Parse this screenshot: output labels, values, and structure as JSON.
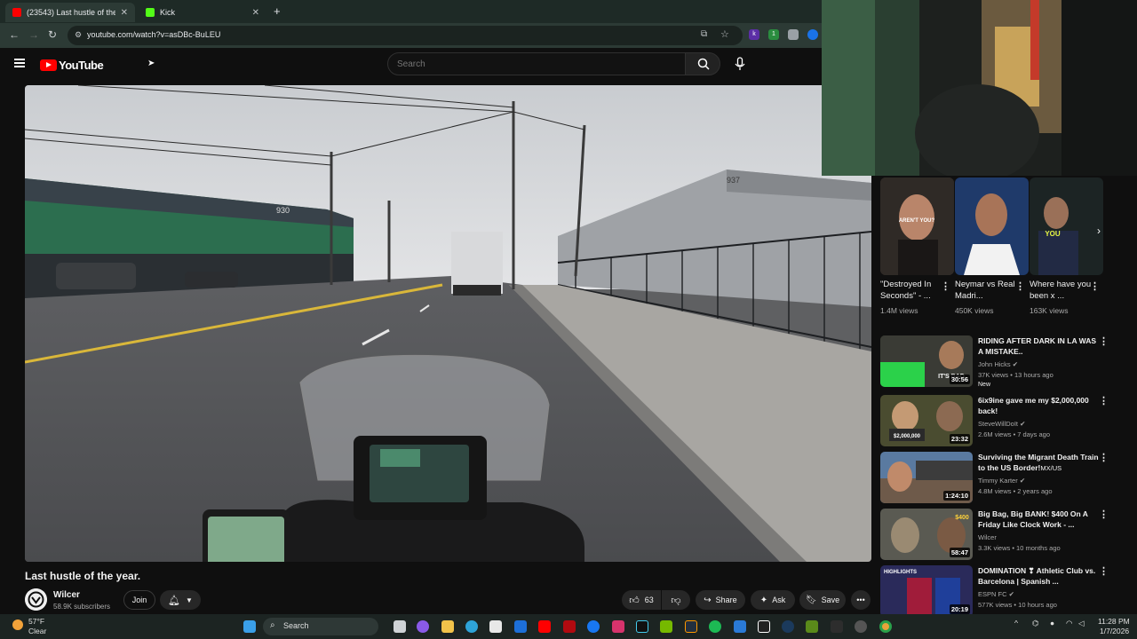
{
  "browser": {
    "tabs": [
      {
        "title": "(23543) Last hustle of the year.",
        "active": true,
        "favicon_color": "#ff0000"
      },
      {
        "title": "Kick",
        "active": false,
        "favicon_color": "#53fc18"
      }
    ],
    "url": "youtube.com/watch?v=asDBc-BuLEU"
  },
  "youtube": {
    "logo_text": "YouTube",
    "search_placeholder": "Search"
  },
  "video": {
    "title": "Last hustle of the year.",
    "channel": "Wilcer",
    "subscribers": "58.9K subscribers",
    "join_label": "Join",
    "likes": "63",
    "share_label": "Share",
    "ask_label": "Ask",
    "save_label": "Save",
    "scene_numbers": {
      "building_left": "930",
      "building_right": "937"
    }
  },
  "shorts": [
    {
      "title": "\"Destroyed In Seconds\" - ...",
      "views": "1.4M views",
      "overlay": "AREN'T YOU?"
    },
    {
      "title": "Neymar vs Real Madri...",
      "views": "450K views"
    },
    {
      "title": "Where have you been x ...",
      "views": "163K views",
      "overlay": "YOU"
    }
  ],
  "recommendations": [
    {
      "title": "RIDING AFTER DARK IN LA WAS A MISTAKE..",
      "channel": "John Hicks",
      "meta": "37K views • 13 hours ago",
      "badge": "New",
      "duration": "30:56",
      "thumb_text": "IT'S BAD"
    },
    {
      "title": "6ix9ine gave me my $2,000,000 back!",
      "channel": "SteveWillDoIt",
      "meta": "2.6M views • 7 days ago",
      "duration": "23:32",
      "thumb_text": "$2,000,000"
    },
    {
      "title": "Surviving the Migrant Death Train to the US Border!",
      "title_suffix": "MX/US",
      "channel": "Timmy Karter",
      "meta": "4.8M views • 2 years ago",
      "duration": "1:24:10"
    },
    {
      "title": "Big Bag, Big BANK! $400 On A Friday Like Clock Work - ...",
      "channel": "Wilcer",
      "meta": "3.3K views • 10 months ago",
      "duration": "58:47",
      "thumb_text": "$400"
    },
    {
      "title": "DOMINATION ❣ Athletic Club vs. Barcelona | Spanish ...",
      "channel": "ESPN FC",
      "meta": "577K views • 10 hours ago",
      "duration": "20:19",
      "thumb_text": "HIGHLIGHTS"
    }
  ],
  "taskbar": {
    "weather_temp": "57°F",
    "weather_desc": "Clear",
    "search_label": "Search",
    "time": "11:28 PM",
    "date": "1/7/2026"
  },
  "colors": {
    "yt_red": "#ff0000",
    "page_bg": "#0f0f0f",
    "chrome_bg": "#1e2a26"
  }
}
